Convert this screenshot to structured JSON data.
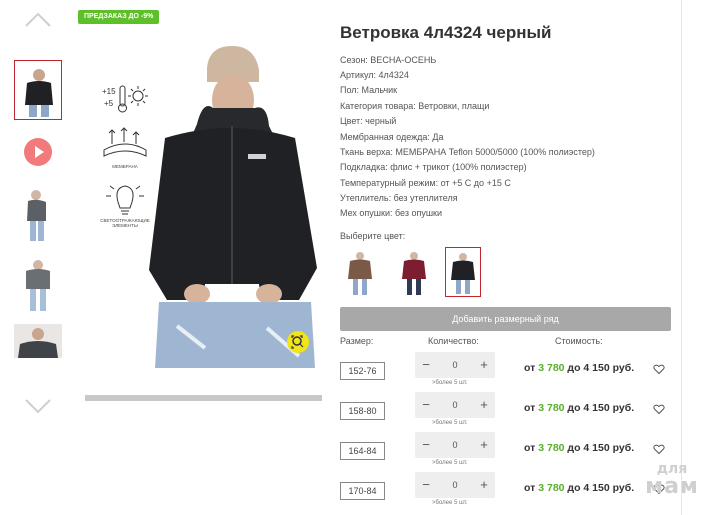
{
  "gallery": {
    "promo_badge": "ПРЕДЗАКАЗ ДО -9%",
    "features": [
      {
        "icon": "temperature-icon",
        "label": ""
      },
      {
        "icon": "membrane-icon",
        "label": "МЕМБРАНА"
      },
      {
        "icon": "reflective-lamp-icon",
        "label": "СВЕТООТРАЖАЮЩИЕ ЭЛЕМЕНТЫ"
      }
    ],
    "temp_text": "+15 +5"
  },
  "product": {
    "title": "Ветровка 4л4324 черный",
    "specs": [
      "Сезон: ВЕСНА-ОСЕНЬ",
      "Артикул: 4л4324",
      "Пол: Мальчик",
      "Категория товара: Ветровки, плащи",
      "Цвет: черный",
      "Мембранная одежда: Да",
      "Ткань верха: МЕМБРАНА Teflon 5000/5000 (100% полиэстер)",
      "Подкладка: флис + трикот (100% полиэстер)",
      "Температурный режим: от +5 С до +15 С",
      "Утеплитель: без утеплителя",
      "Мех опушки: без опушки"
    ],
    "choose_color_label": "Выберите цвет:",
    "add_size_button": "Добавить размерный ряд",
    "columns": {
      "size": "Размер:",
      "qty": "Количество:",
      "cost": "Стоимость:"
    },
    "rows": [
      {
        "size": "152-76",
        "qty": "0",
        "more": ">более 5 шт.",
        "price_from": "от ",
        "price_low": "3 780",
        "price_to": " до 4 150 руб."
      },
      {
        "size": "158-80",
        "qty": "0",
        "more": ">более 5 шт.",
        "price_from": "от ",
        "price_low": "3 780",
        "price_to": " до 4 150 руб."
      },
      {
        "size": "164-84",
        "qty": "0",
        "more": ">более 5 шт.",
        "price_from": "от ",
        "price_low": "3 780",
        "price_to": " до 4 150 руб."
      },
      {
        "size": "170-84",
        "qty": "0",
        "more": ">более 5 шт.",
        "price_from": "от ",
        "price_low": "3 780",
        "price_to": " до 4 150 руб."
      }
    ]
  },
  "watermark": {
    "line1": "для",
    "line2": "мам"
  },
  "colors": {
    "accent_red": "#c0262e",
    "price_green": "#58ad2a",
    "badge_green": "#5fbf2a",
    "zoom_yellow": "#f1e419",
    "play_pink": "#f07a7c"
  }
}
